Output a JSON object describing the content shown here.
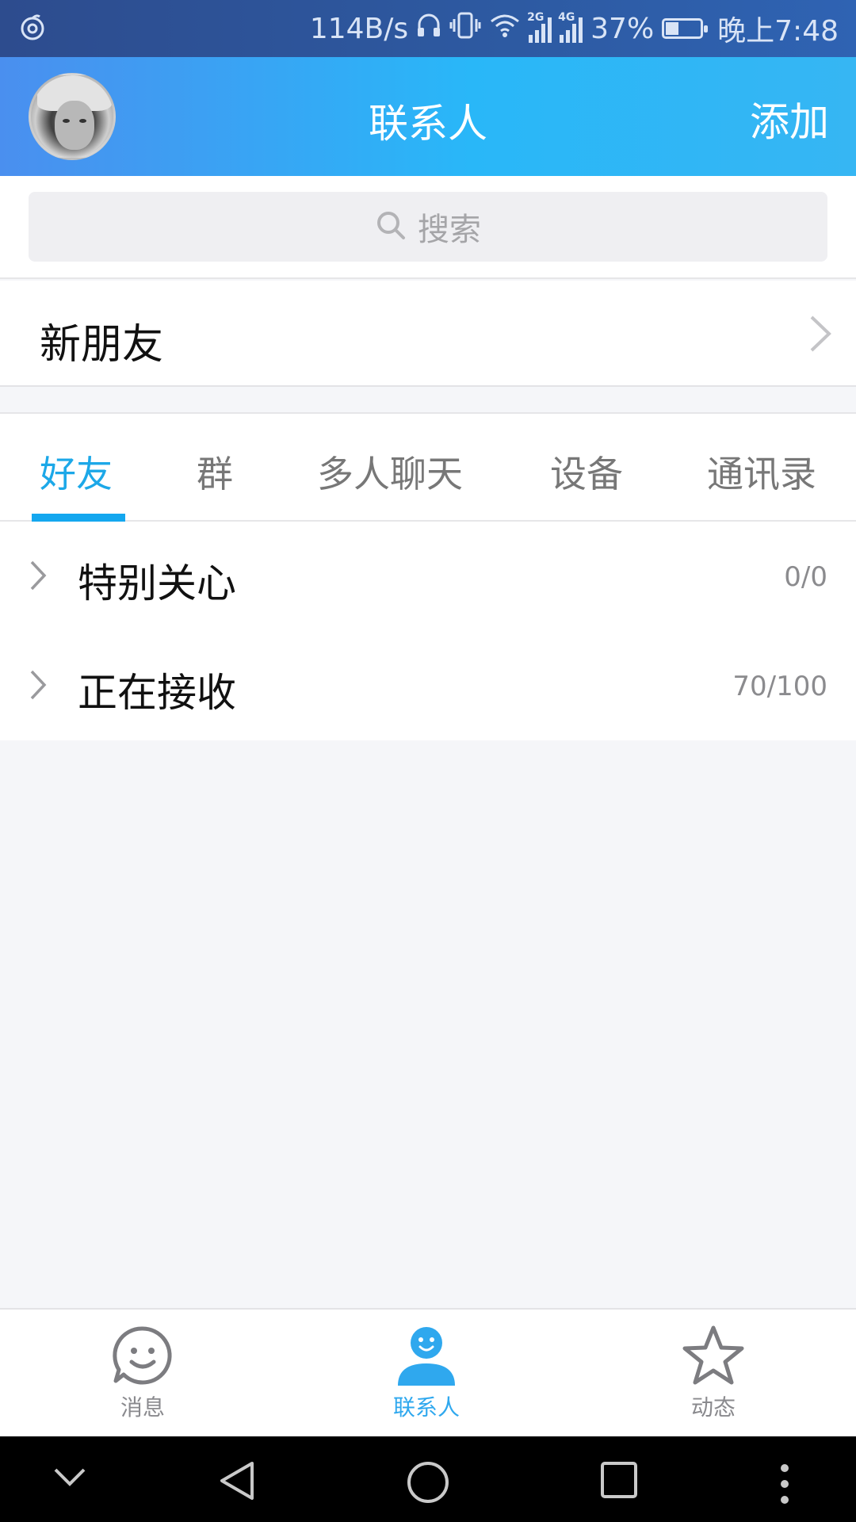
{
  "status_bar": {
    "speed": "114B/s",
    "net_a": "2G",
    "net_b": "4G",
    "battery": "37%",
    "battery_level": 0.37,
    "time": "晚上7:48"
  },
  "header": {
    "title": "联系人",
    "add_label": "添加"
  },
  "search": {
    "placeholder": "搜索"
  },
  "new_friends": {
    "label": "新朋友"
  },
  "tabs": [
    {
      "label": "好友",
      "active": true
    },
    {
      "label": "群",
      "active": false
    },
    {
      "label": "多人聊天",
      "active": false
    },
    {
      "label": "设备",
      "active": false
    },
    {
      "label": "通讯录",
      "active": false
    }
  ],
  "groups": [
    {
      "name": "特别关心",
      "count": "0/0"
    },
    {
      "name": "正在接收",
      "count": "70/100"
    }
  ],
  "bottom_nav": [
    {
      "label": "消息",
      "icon": "smile-chat-icon",
      "active": false
    },
    {
      "label": "联系人",
      "icon": "person-icon",
      "active": true
    },
    {
      "label": "动态",
      "icon": "star-icon",
      "active": false
    }
  ],
  "colors": {
    "accent": "#1ca8e8",
    "header_start": "#4a8fef",
    "header_end": "#29b7f8"
  }
}
